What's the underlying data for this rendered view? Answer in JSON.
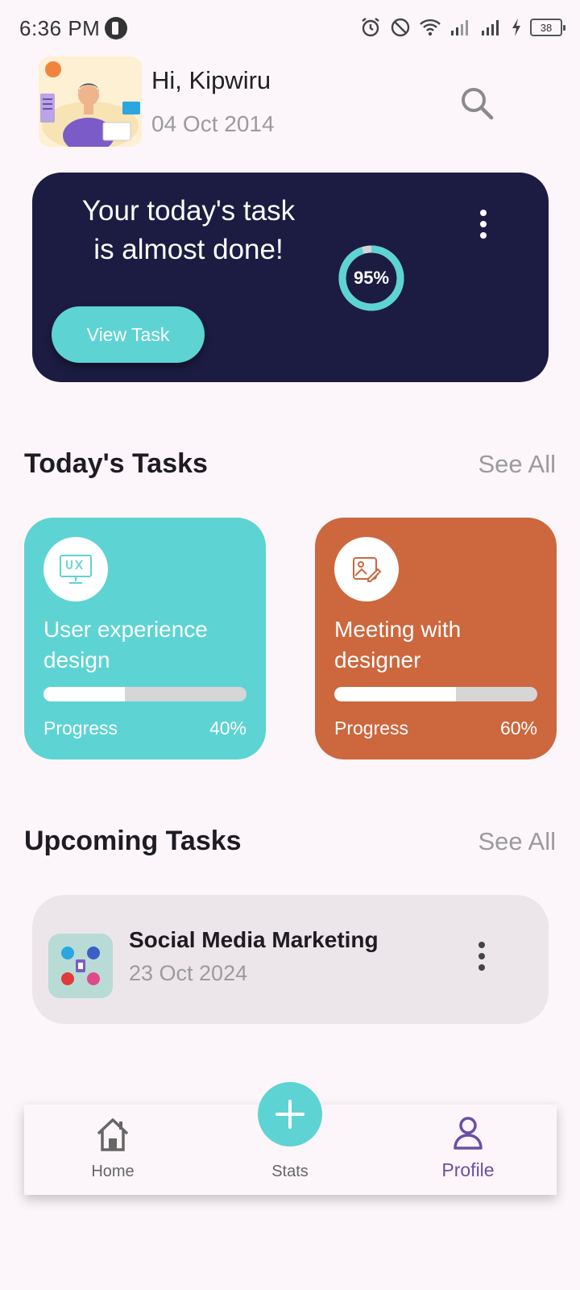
{
  "status_bar": {
    "time": "6:36 PM",
    "battery": "38",
    "icons": [
      "alarm-icon",
      "do-not-disturb-icon",
      "wifi-icon",
      "signal-icon",
      "signal-icon",
      "charging-icon",
      "battery-icon"
    ]
  },
  "header": {
    "greeting": "Hi, Kipwiru",
    "date": "04 Oct 2014"
  },
  "hero": {
    "title_line1": "Your today's task",
    "title_line2": "is almost done!",
    "button_label": "View Task",
    "progress": 0.95,
    "progress_label": "95%"
  },
  "todays_tasks": {
    "title": "Today's Tasks",
    "see_all": "See All",
    "items": [
      {
        "title_line1": "User experience",
        "title_line2": "design",
        "progress_label": "Progress",
        "progress_value": "40%",
        "progress": 0.4,
        "color": "#5ed3d3",
        "icon": "ux-monitor-icon"
      },
      {
        "title_line1": "Meeting with",
        "title_line2": "designer",
        "progress_label": "Progress",
        "progress_value": "60%",
        "progress": 0.6,
        "color": "#cd673e",
        "icon": "image-edit-icon"
      }
    ]
  },
  "upcoming_tasks": {
    "title": "Upcoming Tasks",
    "see_all": "See All",
    "items": [
      {
        "title": "Social Media Marketing",
        "date": "23 Oct 2024",
        "icon": "social-media-icon"
      }
    ]
  },
  "bottom_nav": {
    "items": [
      {
        "label": "Home",
        "icon": "home-icon"
      },
      {
        "label": "Stats",
        "icon": "add-icon"
      },
      {
        "label": "Profile",
        "icon": "profile-icon",
        "active": true
      }
    ]
  },
  "colors": {
    "background": "#fcf6fb",
    "hero_bg": "#1c1c42",
    "accent_teal": "#5ed3d3",
    "accent_orange": "#cd673e",
    "active_nav": "#6a4fa6"
  }
}
